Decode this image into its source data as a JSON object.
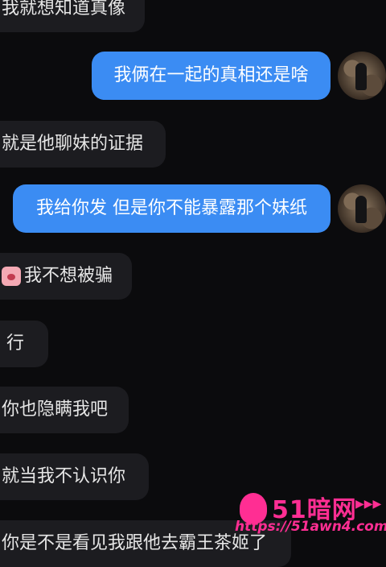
{
  "messages": [
    {
      "side": "in",
      "text": "我就想知道真像"
    },
    {
      "side": "out",
      "text": "我俩在一起的真相还是啥"
    },
    {
      "side": "in",
      "text": "就是他聊妹的证据"
    },
    {
      "side": "out",
      "text": "我给你发 但是你不能暴露那个妹纸"
    },
    {
      "side": "in",
      "text": "我不想被骗",
      "icon": "crying-face-emoji-icon"
    },
    {
      "side": "in",
      "text": "行"
    },
    {
      "side": "in",
      "text": "你也隐瞒我吧"
    },
    {
      "side": "in",
      "text": "就当我不认识你"
    },
    {
      "side": "in",
      "text": "你是不是看见我跟他去霸王茶姬了"
    }
  ],
  "watermark": {
    "title": "51暗网",
    "arrows": "▶▶▶",
    "url": "https://51awn4.com"
  },
  "colors": {
    "background": "#0b0b0d",
    "incoming_bubble": "#1c1c20",
    "outgoing_bubble": "#3b8cf3",
    "watermark": "#ff2e93"
  }
}
